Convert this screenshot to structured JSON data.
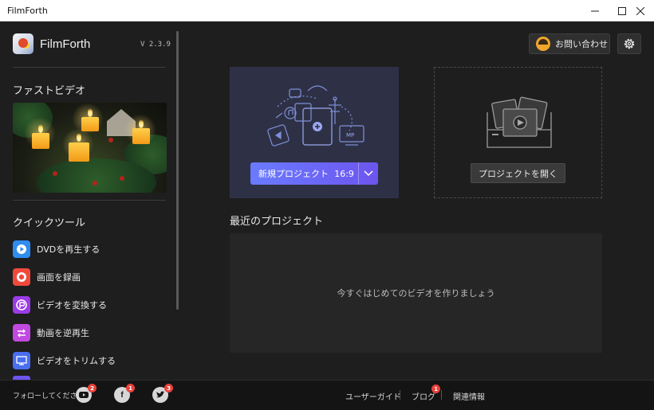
{
  "window": {
    "title": "FilmForth",
    "minimize_icon": "minimize-icon",
    "maximize_icon": "maximize-icon",
    "close_icon": "close-icon"
  },
  "sidebar": {
    "app_name": "FilmForth",
    "version": "V  2.3.9",
    "fast_video_title": "ファストビデオ",
    "quick_tools_title": "クイックツール",
    "tools": [
      {
        "label": "DVDを再生する",
        "icon": "play-icon",
        "color": "#2f8cf0"
      },
      {
        "label": "画面を録画",
        "icon": "record-icon",
        "color": "#f04a3c"
      },
      {
        "label": "ビデオを変換する",
        "icon": "convert-icon",
        "color": "#9b3ce8"
      },
      {
        "label": "動画を逆再生",
        "icon": "reverse-icon",
        "color": "#c04ae0"
      },
      {
        "label": "ビデオをトリムする",
        "icon": "trim-icon",
        "color": "#4a6ef0"
      }
    ]
  },
  "header": {
    "contact_label": "お問い合わせ",
    "settings_icon": "gear-icon"
  },
  "new_project": {
    "label": "新規プロジェクト",
    "ratio": "16:9"
  },
  "open_project": {
    "label": "プロジェクトを開く"
  },
  "recent": {
    "title": "最近のプロジェクト",
    "empty_text": "今すぐはじめてのビデオを作りましょう"
  },
  "footer": {
    "follow_label": "フォローしてください",
    "social": [
      {
        "icon": "youtube-icon",
        "badge": "2"
      },
      {
        "icon": "facebook-icon",
        "badge": "1"
      },
      {
        "icon": "twitter-icon",
        "badge": "3"
      }
    ],
    "links": [
      {
        "label": "ユーザーガイド"
      },
      {
        "label": "ブログ",
        "badge": "1"
      },
      {
        "label": "関連情報"
      }
    ]
  },
  "colors": {
    "accent_start": "#6a7bff",
    "accent_end": "#6d55ee",
    "background": "#1e1e1e",
    "badge": "#e8423b"
  }
}
